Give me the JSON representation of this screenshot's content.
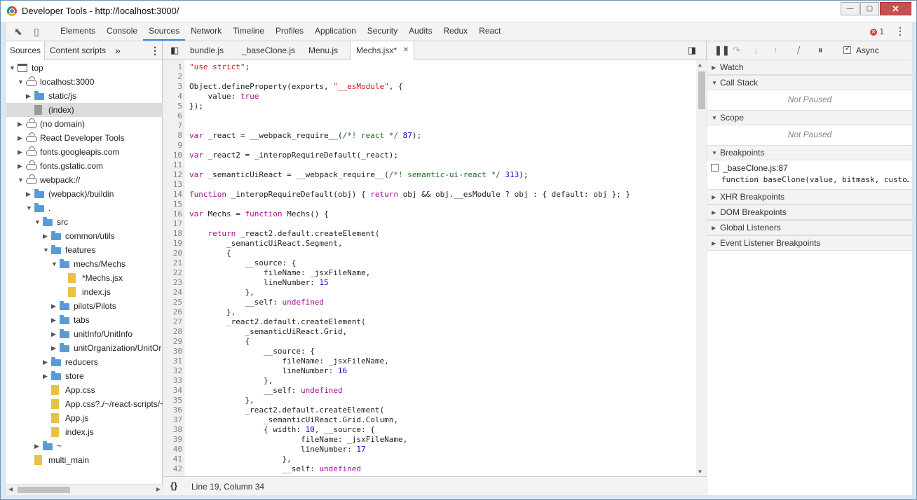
{
  "window": {
    "title": "Developer Tools - http://localhost:3000/",
    "minimize": "—",
    "maximize": "▢",
    "close": "✕"
  },
  "toolbar": {
    "tabs": [
      "Elements",
      "Console",
      "Sources",
      "Network",
      "Timeline",
      "Profiles",
      "Application",
      "Security",
      "Audits",
      "Redux",
      "React"
    ],
    "active_tab": "Sources",
    "error_count": "1"
  },
  "navigator": {
    "tabs": [
      "Sources",
      "Content scripts"
    ],
    "more": "»",
    "tree": [
      {
        "label": "top",
        "depth": 0,
        "arrow": "open",
        "icon": "frame"
      },
      {
        "label": "localhost:3000",
        "depth": 1,
        "arrow": "open",
        "icon": "cloud"
      },
      {
        "label": "static/js",
        "depth": 2,
        "arrow": "closed",
        "icon": "folder"
      },
      {
        "label": "(index)",
        "depth": 2,
        "arrow": "",
        "icon": "file-gray",
        "selected": true
      },
      {
        "label": "(no domain)",
        "depth": 1,
        "arrow": "closed",
        "icon": "cloud"
      },
      {
        "label": "React Developer Tools",
        "depth": 1,
        "arrow": "closed",
        "icon": "cloud"
      },
      {
        "label": "fonts.googleapis.com",
        "depth": 1,
        "arrow": "closed",
        "icon": "cloud"
      },
      {
        "label": "fonts.gstatic.com",
        "depth": 1,
        "arrow": "closed",
        "icon": "cloud"
      },
      {
        "label": "webpack://",
        "depth": 1,
        "arrow": "open",
        "icon": "cloud"
      },
      {
        "label": "(webpack)/buildin",
        "depth": 2,
        "arrow": "closed",
        "icon": "folder"
      },
      {
        "label": ".",
        "depth": 2,
        "arrow": "open",
        "icon": "folder"
      },
      {
        "label": "src",
        "depth": 3,
        "arrow": "open",
        "icon": "folder"
      },
      {
        "label": "common/utils",
        "depth": 4,
        "arrow": "closed",
        "icon": "folder"
      },
      {
        "label": "features",
        "depth": 4,
        "arrow": "open",
        "icon": "folder"
      },
      {
        "label": "mechs/Mechs",
        "depth": 5,
        "arrow": "open",
        "icon": "folder"
      },
      {
        "label": "*Mechs.jsx",
        "depth": 6,
        "arrow": "",
        "icon": "file"
      },
      {
        "label": "index.js",
        "depth": 6,
        "arrow": "",
        "icon": "file"
      },
      {
        "label": "pilots/Pilots",
        "depth": 5,
        "arrow": "closed",
        "icon": "folder"
      },
      {
        "label": "tabs",
        "depth": 5,
        "arrow": "closed",
        "icon": "folder"
      },
      {
        "label": "unitInfo/UnitInfo",
        "depth": 5,
        "arrow": "closed",
        "icon": "folder"
      },
      {
        "label": "unitOrganization/UnitOr",
        "depth": 5,
        "arrow": "closed",
        "icon": "folder"
      },
      {
        "label": "reducers",
        "depth": 4,
        "arrow": "closed",
        "icon": "folder"
      },
      {
        "label": "store",
        "depth": 4,
        "arrow": "closed",
        "icon": "folder"
      },
      {
        "label": "App.css",
        "depth": 4,
        "arrow": "",
        "icon": "file"
      },
      {
        "label": "App.css?./~/react-scripts/~",
        "depth": 4,
        "arrow": "",
        "icon": "file"
      },
      {
        "label": "App.js",
        "depth": 4,
        "arrow": "",
        "icon": "file"
      },
      {
        "label": "index.js",
        "depth": 4,
        "arrow": "",
        "icon": "file"
      },
      {
        "label": "~",
        "depth": 3,
        "arrow": "closed",
        "icon": "folder"
      },
      {
        "label": "multi_main",
        "depth": 2,
        "arrow": "",
        "icon": "file"
      }
    ]
  },
  "editor": {
    "tabs": [
      {
        "label": "bundle.js",
        "active": false
      },
      {
        "label": "_baseClone.js",
        "active": false
      },
      {
        "label": "Menu.js",
        "active": false
      },
      {
        "label": "Mechs.jsx*",
        "active": true
      }
    ],
    "close_tab": "✕",
    "lines": [
      "\"use strict\";",
      "",
      "Object.defineProperty(exports, \"__esModule\", {",
      "    value: true",
      "});",
      "",
      "",
      "var _react = __webpack_require__(/*! react */ 87);",
      "",
      "var _react2 = _interopRequireDefault(_react);",
      "",
      "var _semanticUiReact = __webpack_require__(/*! semantic-ui-react */ 313);",
      "",
      "function _interopRequireDefault(obj) { return obj && obj.__esModule ? obj : { default: obj }; }",
      "",
      "var Mechs = function Mechs() {",
      "",
      "    return _react2.default.createElement(",
      "        _semanticUiReact.Segment,",
      "        {",
      "            __source: {",
      "                fileName: _jsxFileName,",
      "                lineNumber: 15",
      "            },",
      "            __self: undefined",
      "        },",
      "        _react2.default.createElement(",
      "            _semanticUiReact.Grid,",
      "            {",
      "                __source: {",
      "                    fileName: _jsxFileName,",
      "                    lineNumber: 16",
      "                },",
      "                __self: undefined",
      "            },",
      "            _react2.default.createElement(",
      "                _semanticUiReact.Grid.Column,",
      "                { width: 10, __source: {",
      "                        fileName: _jsxFileName,",
      "                        lineNumber: 17",
      "                    },",
      "                    __self: undefined"
    ],
    "status": "Line 19, Column 34",
    "format_icon": "{}"
  },
  "debugger": {
    "async_label": "Async",
    "sections": {
      "watch": "Watch",
      "call_stack": "Call Stack",
      "call_stack_msg": "Not Paused",
      "scope": "Scope",
      "scope_msg": "Not Paused",
      "breakpoints": "Breakpoints",
      "bp_file": "_baseClone.js:87",
      "bp_code": "function baseClone(value, bitmask, custo…",
      "xhr": "XHR Breakpoints",
      "dom": "DOM Breakpoints",
      "global": "Global Listeners",
      "event": "Event Listener Breakpoints"
    }
  },
  "colors": {
    "string": "#c41a16",
    "number": "#1c00cf",
    "keyword": "#aa0d91",
    "comment": "#236e25",
    "accent": "#3e82f7"
  }
}
